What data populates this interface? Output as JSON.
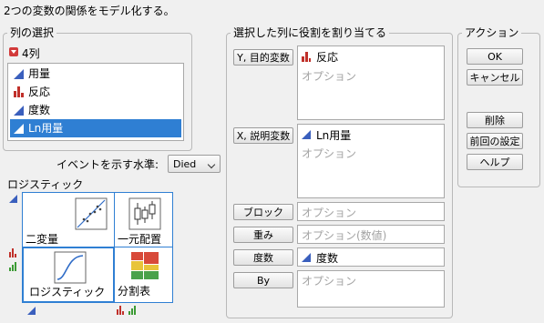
{
  "header": {
    "title": "2つの変数の関係をモデル化する。"
  },
  "column_selection": {
    "title": "列の選択",
    "count_label": "4列",
    "items": [
      {
        "label": "用量",
        "icon": "continuous-icon",
        "selected": false
      },
      {
        "label": "反応",
        "icon": "nominal-icon",
        "selected": false
      },
      {
        "label": "度数",
        "icon": "continuous-icon",
        "selected": false
      },
      {
        "label": "Ln用量",
        "icon": "continuous-icon",
        "selected": true
      }
    ]
  },
  "event_level": {
    "label": "イベントを示す水準:",
    "value": "Died"
  },
  "platform": {
    "title": "ロジスティック",
    "cells": [
      {
        "label": "二変量"
      },
      {
        "label": "一元配置"
      },
      {
        "label": "ロジスティック"
      },
      {
        "label": "分割表"
      }
    ]
  },
  "roles": {
    "title": "選択した列に役割を割り当てる",
    "y_button": "Y, 目的変数",
    "y_value": "反応",
    "y_placeholder": "オプション",
    "x_button": "X, 説明変数",
    "x_value": "Ln用量",
    "x_placeholder": "オプション",
    "block_button": "ブロック",
    "block_placeholder": "オプション",
    "weight_button": "重み",
    "weight_placeholder": "オプション(数値)",
    "freq_button": "度数",
    "freq_value": "度数",
    "by_button": "By",
    "by_placeholder": "オプション"
  },
  "actions": {
    "title": "アクション",
    "ok": "OK",
    "cancel": "キャンセル",
    "remove": "削除",
    "recall": "前回の設定",
    "help": "ヘルプ"
  },
  "colors": {
    "selection": "#2f7fd3",
    "continuous": "#3a5fbd",
    "nominal": "#c0302a",
    "ordinal": "#3c9b35"
  }
}
